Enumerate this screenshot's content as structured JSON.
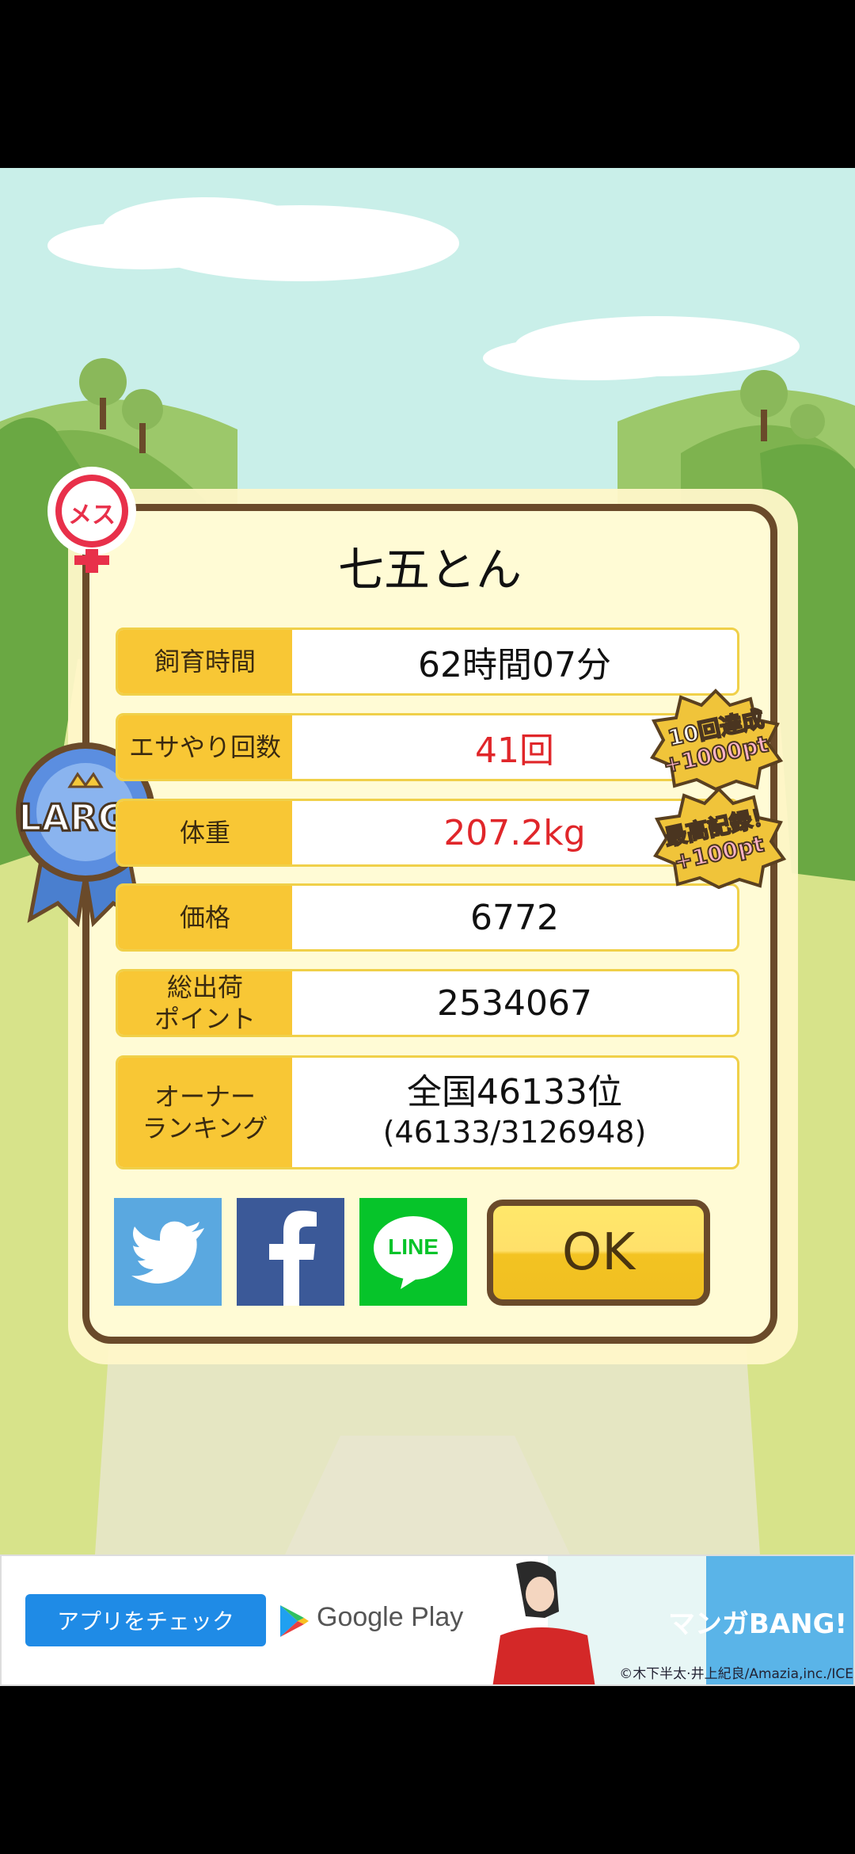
{
  "gender_badge": "メス",
  "size_badge": "LARGE",
  "title": "七五とん",
  "stats": [
    {
      "label": "飼育時間",
      "value": "62時間07分"
    },
    {
      "label": "エサやり回数",
      "value": "41回"
    },
    {
      "label": "体重",
      "value": "207.2kg"
    },
    {
      "label": "価格",
      "value": "6772"
    },
    {
      "label": "総出荷\nポイント",
      "value": "2534067"
    },
    {
      "label": "オーナー\nランキング",
      "value_line1": "全国46133位",
      "value_line2": "(46133/3126948)"
    }
  ],
  "bonus_badges": [
    {
      "line1": "10回達成",
      "line2": "+1000pt"
    },
    {
      "line1": "最高記録！",
      "line2": "+100pt"
    }
  ],
  "share": {
    "twitter_icon": "twitter-bird-icon",
    "facebook_icon": "facebook-f-icon",
    "line_label": "LINE"
  },
  "ok_label": "OK",
  "ad": {
    "button_label": "アプリをチェック",
    "store_label": "Google Play",
    "brand_label": "マンガBANG!",
    "copyright": "©木下半太·井上紀良/Amazia,inc./ICE"
  },
  "colors": {
    "highlight_value": "#e0262a",
    "label_bg": "#f8c735",
    "dialog_border": "#6a4a2a",
    "twitter": "#5aa8e0",
    "facebook": "#3b5998",
    "line": "#06c42a"
  }
}
